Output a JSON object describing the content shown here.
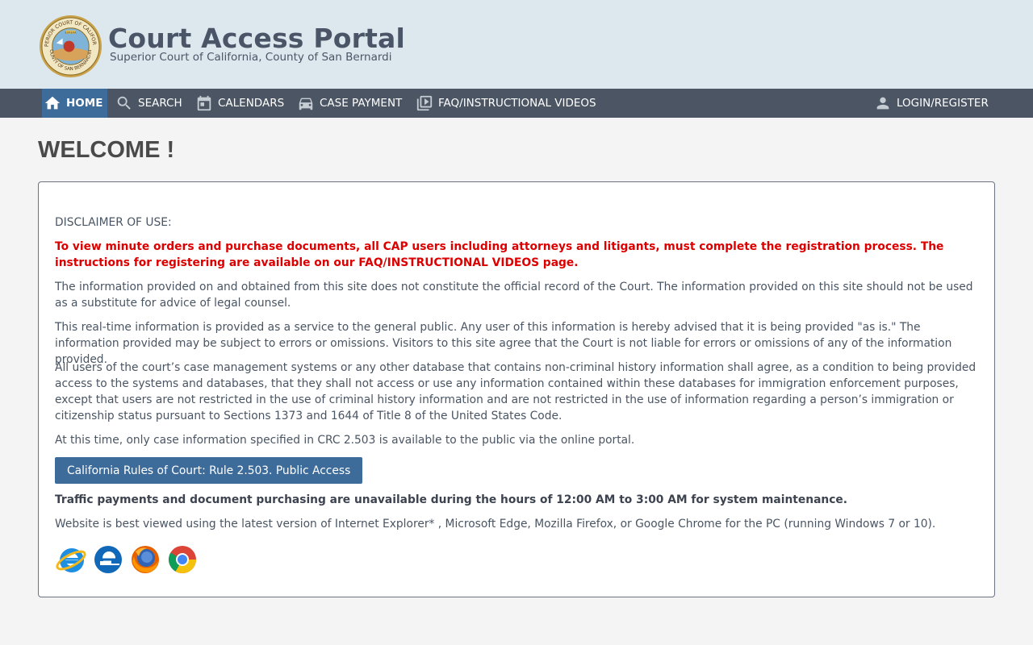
{
  "header": {
    "title": "Court Access Portal",
    "subtitle": "Superior Court of California, County of San Bernardi",
    "seal": {
      "top_text": "SUPERIOR COURT OF CALIFORNIA",
      "bottom_text": "COUNTY OF SAN BERNARDINO",
      "banner": "EUREKA"
    }
  },
  "nav": {
    "items": [
      {
        "label": "HOME",
        "icon": "home-icon",
        "active": true
      },
      {
        "label": "SEARCH",
        "icon": "search-icon"
      },
      {
        "label": "CALENDARS",
        "icon": "calendar-icon"
      },
      {
        "label": "CASE PAYMENT",
        "icon": "car-icon"
      },
      {
        "label": "FAQ/INSTRUCTIONAL VIDEOS",
        "icon": "video-library-icon"
      }
    ],
    "login": {
      "label": "LOGIN/REGISTER",
      "icon": "user-icon"
    }
  },
  "main": {
    "heading": "WELCOME !",
    "disclaimer_heading": "DISCLAIMER OF USE:",
    "registration_notice": "To view minute orders and purchase documents, all CAP users including attorneys and litigants, must complete the registration process. The instructions for registering are available on our FAQ/INSTRUCTIONAL VIDEOS page.",
    "paragraphs": [
      "The information provided on and obtained from this site does not constitute the official record of the Court. The information provided on this site should not be used as a substitute for advice of legal counsel.",
      "This real-time information is provided as a service to the general public. Any user of this information is hereby advised that it is being provided \"as is.\" The information provided may be subject to errors or omissions. Visitors to this site agree that the Court is not liable for errors or omissions of any of the information provided.",
      "All users of the court’s case management systems or any other database that contains non-criminal history information shall agree, as a condition to being provided access to the systems and databases, that they shall not access or use any information contained within these databases for immigration enforcement purposes, except that users are not restricted in the use of criminal history information and are not restricted in the use of information regarding a person’s immigration or citizenship status pursuant to Sections 1373 and 1644 of Title 8 of the United States Code.",
      "At this time, only case information specified in CRC 2.503 is available to the public via the online portal."
    ],
    "rule_button_label": "California Rules of Court: Rule 2.503. Public Access",
    "maintenance_notice": "Traffic payments and document purchasing are unavailable during the hours of 12:00 AM to 3:00 AM for system maintenance.",
    "browser_notice": "Website is best viewed using the latest version of Internet Explorer* , Microsoft Edge, Mozilla Firefox, or Google Chrome for the PC (running Windows 7 or 10).",
    "browser_icons": [
      "internet-explorer-icon",
      "microsoft-edge-icon",
      "firefox-icon",
      "chrome-icon"
    ]
  },
  "colors": {
    "header_bg": "#dde8ee",
    "nav_bg": "#4b5563",
    "accent": "#3d6b9a",
    "warning_red": "#dc0000"
  }
}
